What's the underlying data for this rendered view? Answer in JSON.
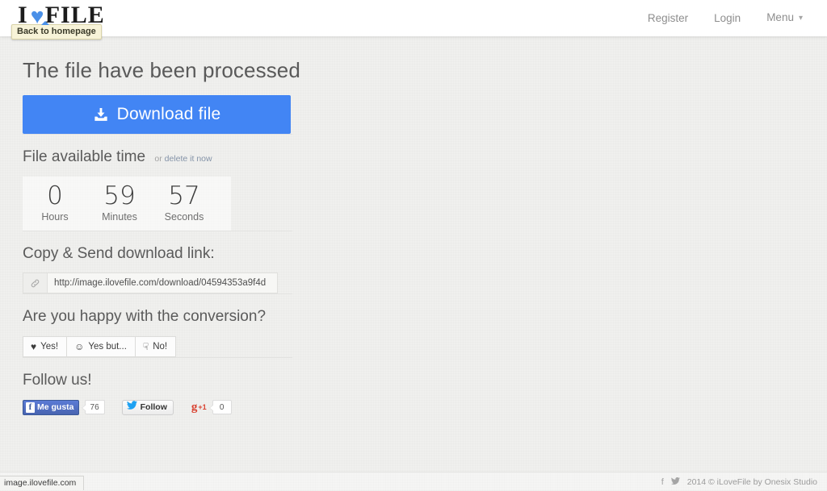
{
  "header": {
    "logo": {
      "pre": "I",
      "heart_icon": "heart-icon",
      "post": "FILE"
    },
    "tooltip": "Back to homepage",
    "nav": [
      {
        "label": "Register"
      },
      {
        "label": "Login"
      },
      {
        "label": "Menu",
        "caret": "⌄"
      }
    ]
  },
  "main": {
    "page_title": "The file have been processed",
    "download_button": "Download file",
    "available": {
      "title": "File available time",
      "or_text": "or",
      "delete_link": "delete it now",
      "units": [
        {
          "value": "0",
          "label": "Hours"
        },
        {
          "value": "59",
          "label": "Minutes"
        },
        {
          "value": "57",
          "label": "Seconds"
        }
      ]
    },
    "share": {
      "title": "Copy & Send download link:",
      "link_icon": "link-icon",
      "url": "http://image.ilovefile.com/download/04594353a9f4d"
    },
    "feedback": {
      "title": "Are you happy with the conversion?",
      "options": [
        {
          "icon": "♥",
          "icon_name": "heart-icon",
          "label": "Yes!"
        },
        {
          "icon": "☺",
          "icon_name": "smiley-icon",
          "label": "Yes but..."
        },
        {
          "icon": "☟",
          "icon_name": "thumbs-down-icon",
          "label": "No!"
        }
      ]
    },
    "follow": {
      "title": "Follow us!",
      "facebook": {
        "f": "f",
        "label": "Me gusta",
        "count": "76"
      },
      "twitter": {
        "label": "Follow"
      },
      "google": {
        "mark": "g",
        "plus": "+1",
        "count": "0"
      }
    }
  },
  "footer": {
    "facebook_icon": "f",
    "twitter_icon": "twitter-icon",
    "copyright": "2014 © iLoveFile by Onesix Studio"
  },
  "browser": {
    "status_url": "image.ilovefile.com"
  },
  "colors": {
    "accent": "#4285f4",
    "heart": "#4a90e8",
    "facebook": "#3b5998",
    "google": "#d94130"
  }
}
